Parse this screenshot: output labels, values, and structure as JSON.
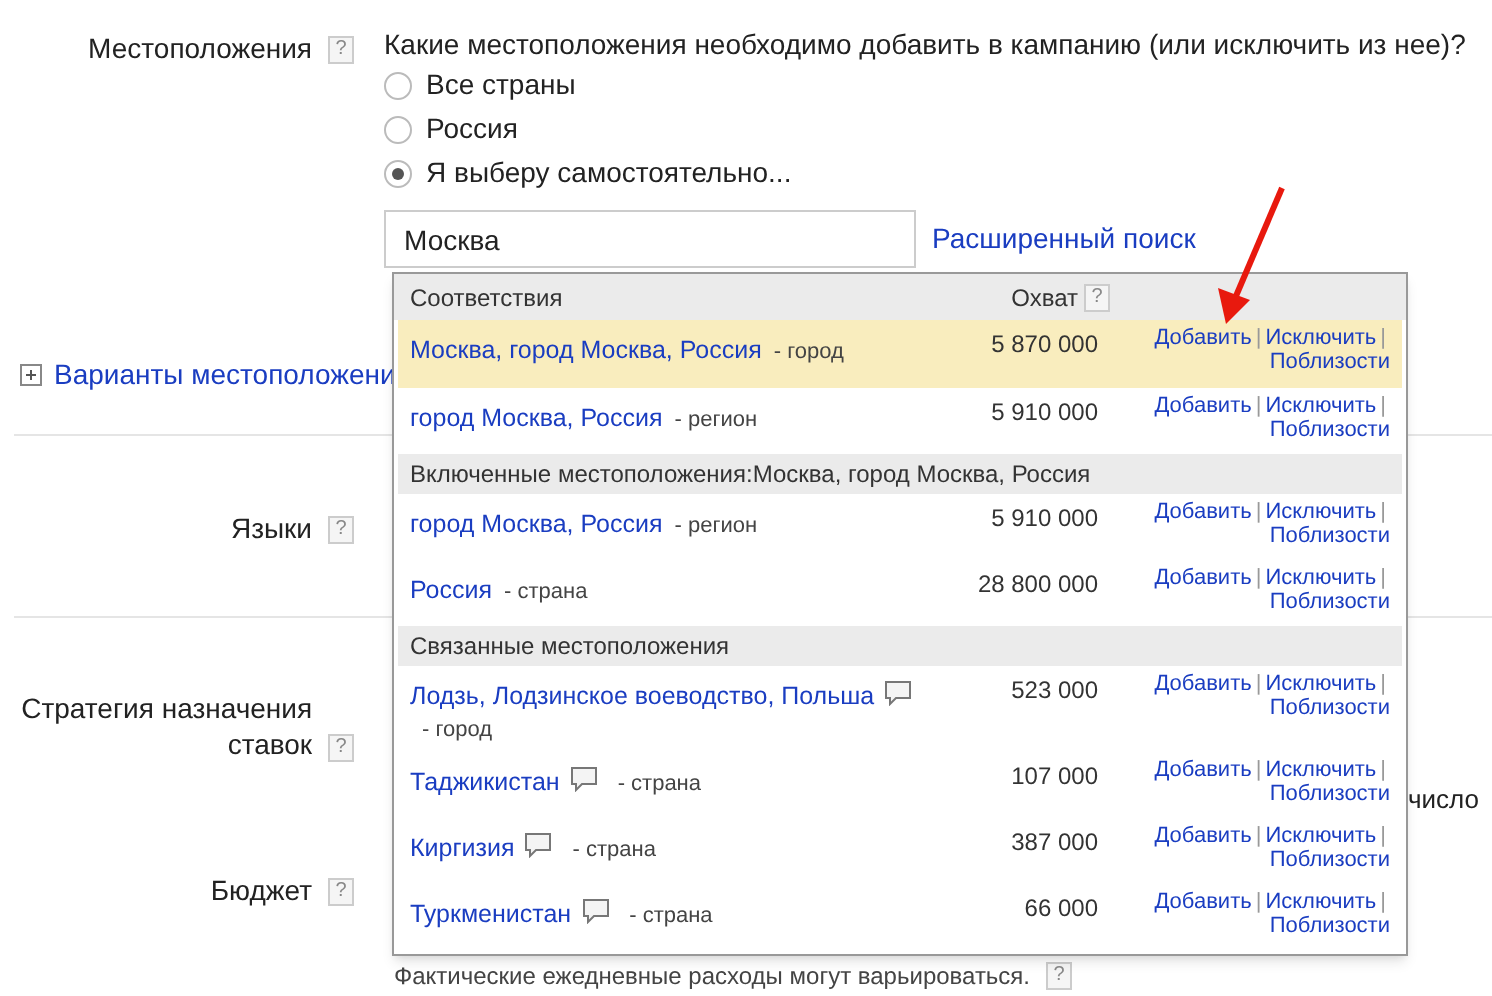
{
  "locations": {
    "label": "Местоположения",
    "help": "?",
    "question": "Какие местоположения необходимо добавить в кампанию (или исключить из нее)?",
    "radios": [
      {
        "label": "Все страны",
        "selected": false
      },
      {
        "label": "Россия",
        "selected": false
      },
      {
        "label": "Я выберу самостоятельно...",
        "selected": true
      }
    ],
    "search": {
      "value": "Москва"
    },
    "advanced_search": "Расширенный поиск",
    "options_link": "Варианты местоположени"
  },
  "languages": {
    "label": "Языки",
    "help": "?"
  },
  "bid_strategy": {
    "label": "Стратегия назначения ставок",
    "help": "?",
    "fragment": "число"
  },
  "budget": {
    "label": "Бюджет",
    "help": "?",
    "note": "Фактические ежедневные расходы могут варьироваться.",
    "note_help": "?"
  },
  "dropdown": {
    "reach_header": "Охват",
    "reach_help": "?",
    "sections": [
      {
        "title": "Соответствия",
        "rows": [
          {
            "name": "Москва, город Москва, Россия",
            "type": "- город",
            "reach": "5 870 000",
            "highlighted": true,
            "comment": false,
            "actions": [
              "Добавить",
              "Исключить",
              "Поблизости"
            ],
            "separators": [
              "|",
              "|"
            ]
          },
          {
            "name": "город Москва, Россия",
            "type": "- регион",
            "reach": "5 910 000",
            "highlighted": false,
            "comment": false,
            "actions": [
              "Добавить",
              "Исключить",
              "Поблизости"
            ],
            "separators": [
              "|",
              "|"
            ]
          }
        ]
      },
      {
        "title": "Включенные местоположения:Москва, город Москва, Россия",
        "rows": [
          {
            "name": "город Москва, Россия",
            "type": "- регион",
            "reach": "5 910 000",
            "highlighted": false,
            "comment": false,
            "actions": [
              "Добавить",
              "Исключить",
              "Поблизости"
            ],
            "separators": [
              "|",
              "|"
            ]
          },
          {
            "name": "Россия",
            "type": "- страна",
            "reach": "28 800 000",
            "highlighted": false,
            "comment": false,
            "actions": [
              "Добавить",
              "Исключить",
              "Поблизости"
            ],
            "separators": [
              "|",
              "|"
            ]
          }
        ]
      },
      {
        "title": "Связанные местоположения",
        "rows": [
          {
            "name": "Лодзь, Лодзинское воеводство, Польша",
            "type": "- город",
            "reach": "523 000",
            "highlighted": false,
            "comment": true,
            "actions": [
              "Добавить",
              "Исключить",
              "Поблизости"
            ],
            "separators": [
              "|",
              "|"
            ]
          },
          {
            "name": "Таджикистан",
            "type": "- страна",
            "reach": "107 000",
            "highlighted": false,
            "comment": true,
            "actions": [
              "Добавить",
              "Исключить",
              "Поблизости"
            ],
            "separators": [
              "|",
              "|"
            ]
          },
          {
            "name": "Киргизия",
            "type": "- страна",
            "reach": "387 000",
            "highlighted": false,
            "comment": true,
            "actions": [
              "Добавить",
              "Исключить",
              "Поблизости"
            ],
            "separators": [
              "|",
              "|"
            ]
          },
          {
            "name": "Туркменистан",
            "type": "- страна",
            "reach": "66 000",
            "highlighted": false,
            "comment": true,
            "actions": [
              "Добавить",
              "Исключить",
              "Поблизости"
            ],
            "separators": [
              "|",
              "|"
            ]
          }
        ]
      }
    ]
  }
}
